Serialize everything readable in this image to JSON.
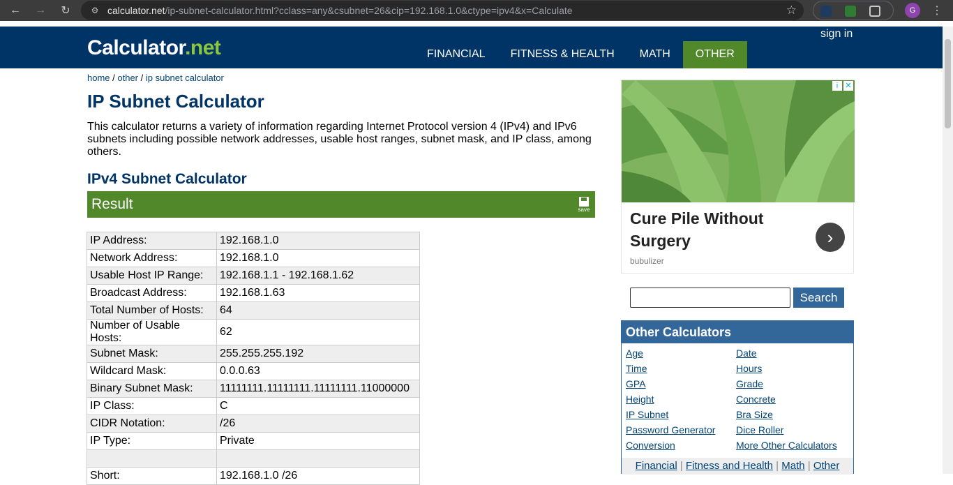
{
  "browser": {
    "url_host": "calculator.net",
    "url_rest": "/ip-subnet-calculator.html?cclass=any&csubnet=26&cip=192.168.1.0&ctype=ipv4&x=Calculate",
    "profile_initial": "G"
  },
  "header": {
    "logo_main": "Calculator",
    "logo_dot_net": ".net",
    "sign_in": "sign in",
    "nav": [
      "FINANCIAL",
      "FITNESS & HEALTH",
      "MATH",
      "OTHER"
    ]
  },
  "breadcrumb": {
    "home": "home",
    "sep": " / ",
    "other": "other",
    "current": "ip subnet calculator"
  },
  "page_title": "IP Subnet Calculator",
  "intro": "This calculator returns a variety of information regarding Internet Protocol version 4 (IPv4) and IPv6 subnets including possible network addresses, usable host ranges, subnet mask, and IP class, among others.",
  "section_title": "IPv4 Subnet Calculator",
  "result": {
    "label": "Result",
    "save_caption": "save",
    "rows": [
      {
        "k": "IP Address:",
        "v": "192.168.1.0"
      },
      {
        "k": "Network Address:",
        "v": "192.168.1.0"
      },
      {
        "k": "Usable Host IP Range:",
        "v": "192.168.1.1 - 192.168.1.62"
      },
      {
        "k": "Broadcast Address:",
        "v": "192.168.1.63"
      },
      {
        "k": "Total Number of Hosts:",
        "v": "64"
      },
      {
        "k": "Number of Usable Hosts:",
        "v": "62"
      },
      {
        "k": "Subnet Mask:",
        "v": "255.255.255.192"
      },
      {
        "k": "Wildcard Mask:",
        "v": "0.0.0.63"
      },
      {
        "k": "Binary Subnet Mask:",
        "v": "11111111.11111111.11111111.11000000"
      },
      {
        "k": "IP Class:",
        "v": "C"
      },
      {
        "k": "CIDR Notation:",
        "v": "/26"
      },
      {
        "k": "IP Type:",
        "v": "Private"
      },
      {
        "k": "",
        "v": ""
      },
      {
        "k": "Short:",
        "v": "192.168.1.0 /26"
      }
    ]
  },
  "ad": {
    "title": "Cure Pile Without Surgery",
    "source": "bubulizer"
  },
  "search": {
    "button": "Search",
    "value": ""
  },
  "other_calculators": {
    "title": "Other Calculators",
    "left": [
      "Age",
      "Time",
      "GPA",
      "Height",
      "IP Subnet",
      "Password Generator",
      "Conversion"
    ],
    "right": [
      "Date",
      "Hours",
      "Grade",
      "Concrete",
      "Bra Size",
      "Dice Roller",
      "More Other Calculators"
    ],
    "footer": [
      "Financial",
      "Fitness and Health",
      "Math",
      "Other"
    ]
  }
}
